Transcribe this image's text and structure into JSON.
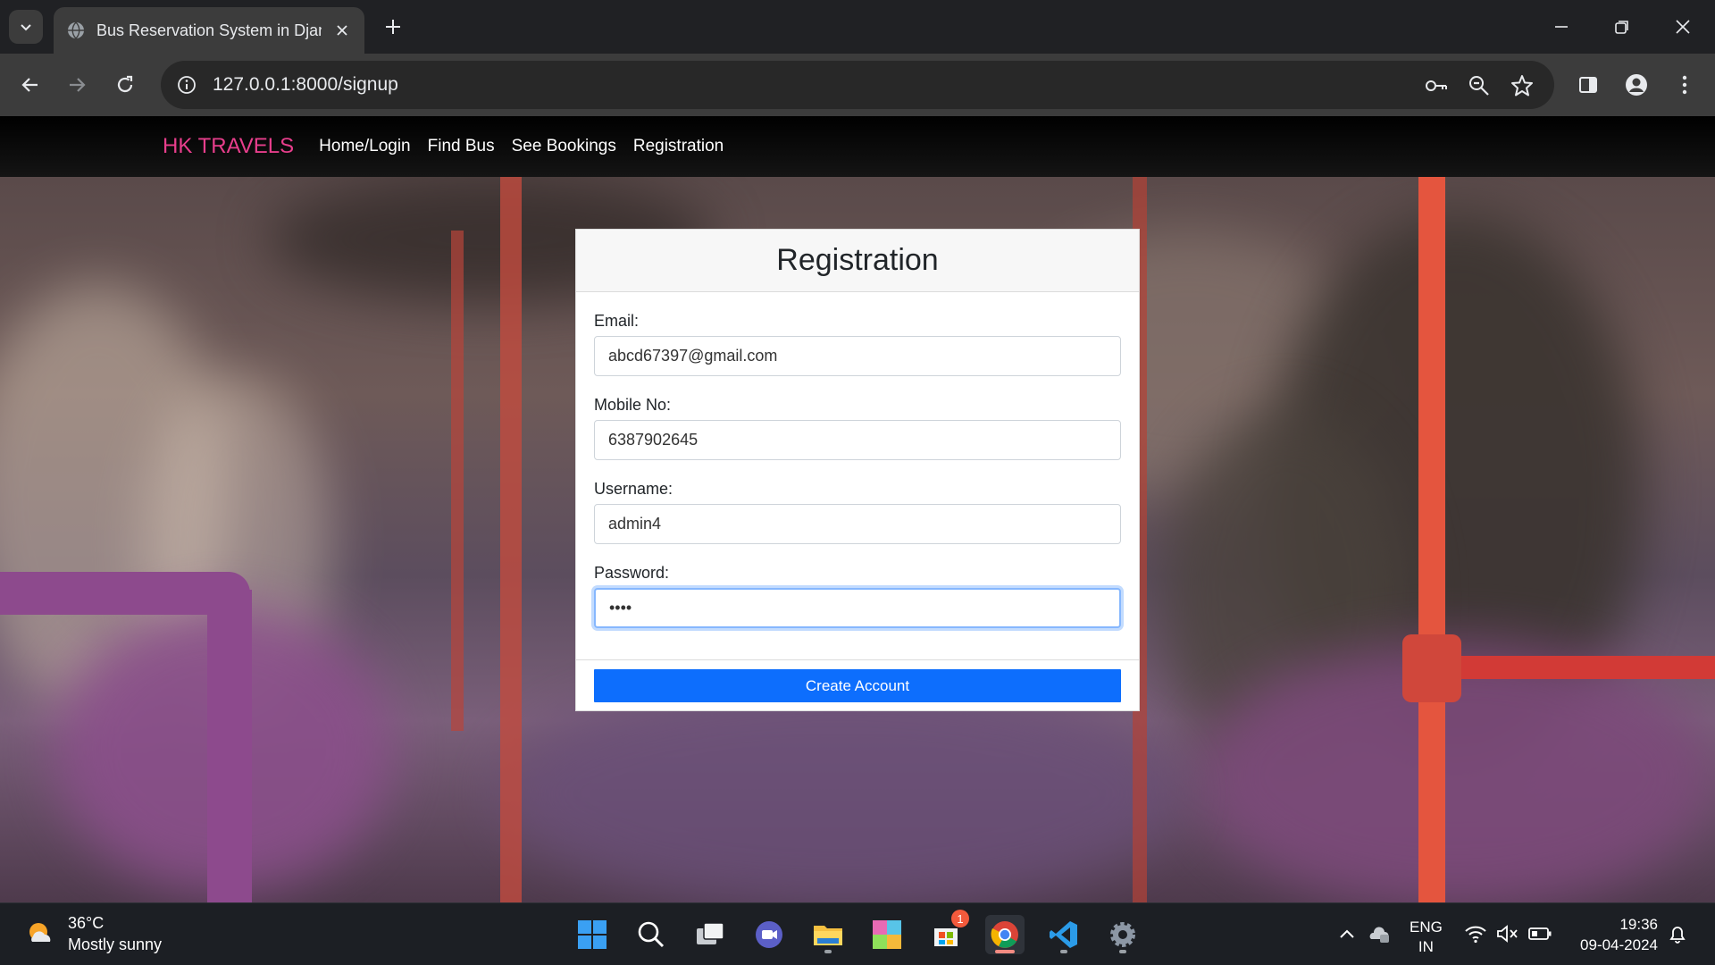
{
  "browser": {
    "tab_title": "Bus Reservation System in Djan",
    "url": "127.0.0.1:8000/signup"
  },
  "site": {
    "brand": "HK TRAVELS",
    "nav": [
      "Home/Login",
      "Find Bus",
      "See Bookings",
      "Registration"
    ]
  },
  "form": {
    "title": "Registration",
    "fields": [
      {
        "label": "Email:",
        "value": "abcd67397@gmail.com"
      },
      {
        "label": "Mobile No:",
        "value": "6387902645"
      },
      {
        "label": "Username:",
        "value": "admin4"
      },
      {
        "label": "Password:",
        "value": "••••"
      }
    ],
    "submit": "Create Account"
  },
  "taskbar": {
    "weather_temp": "36°C",
    "weather_desc": "Mostly sunny",
    "store_badge": "1",
    "lang_line1": "ENG",
    "lang_line2": "IN",
    "time": "19:36",
    "date": "09-04-2024"
  },
  "colors": {
    "brand": "#e83e8c",
    "primary_button": "#0d6efd"
  }
}
